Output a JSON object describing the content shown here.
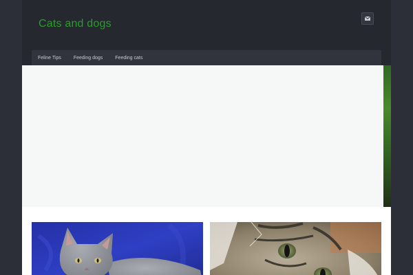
{
  "site": {
    "title": "Cats and dogs"
  },
  "header": {
    "mail_icon": "envelope-icon"
  },
  "nav": {
    "items": [
      {
        "label": "Feline Tips"
      },
      {
        "label": "Feeding dogs"
      },
      {
        "label": "Feeding cats"
      }
    ]
  },
  "posts": [
    {
      "image": "gray-kitten-on-blue-photo"
    },
    {
      "image": "tabby-cat-closeup-photo"
    }
  ],
  "colors": {
    "background": "#2c2f38",
    "header": "#262830",
    "nav": "#31343d",
    "title": "#2a9d2a",
    "hero": "#f6f7f7"
  }
}
